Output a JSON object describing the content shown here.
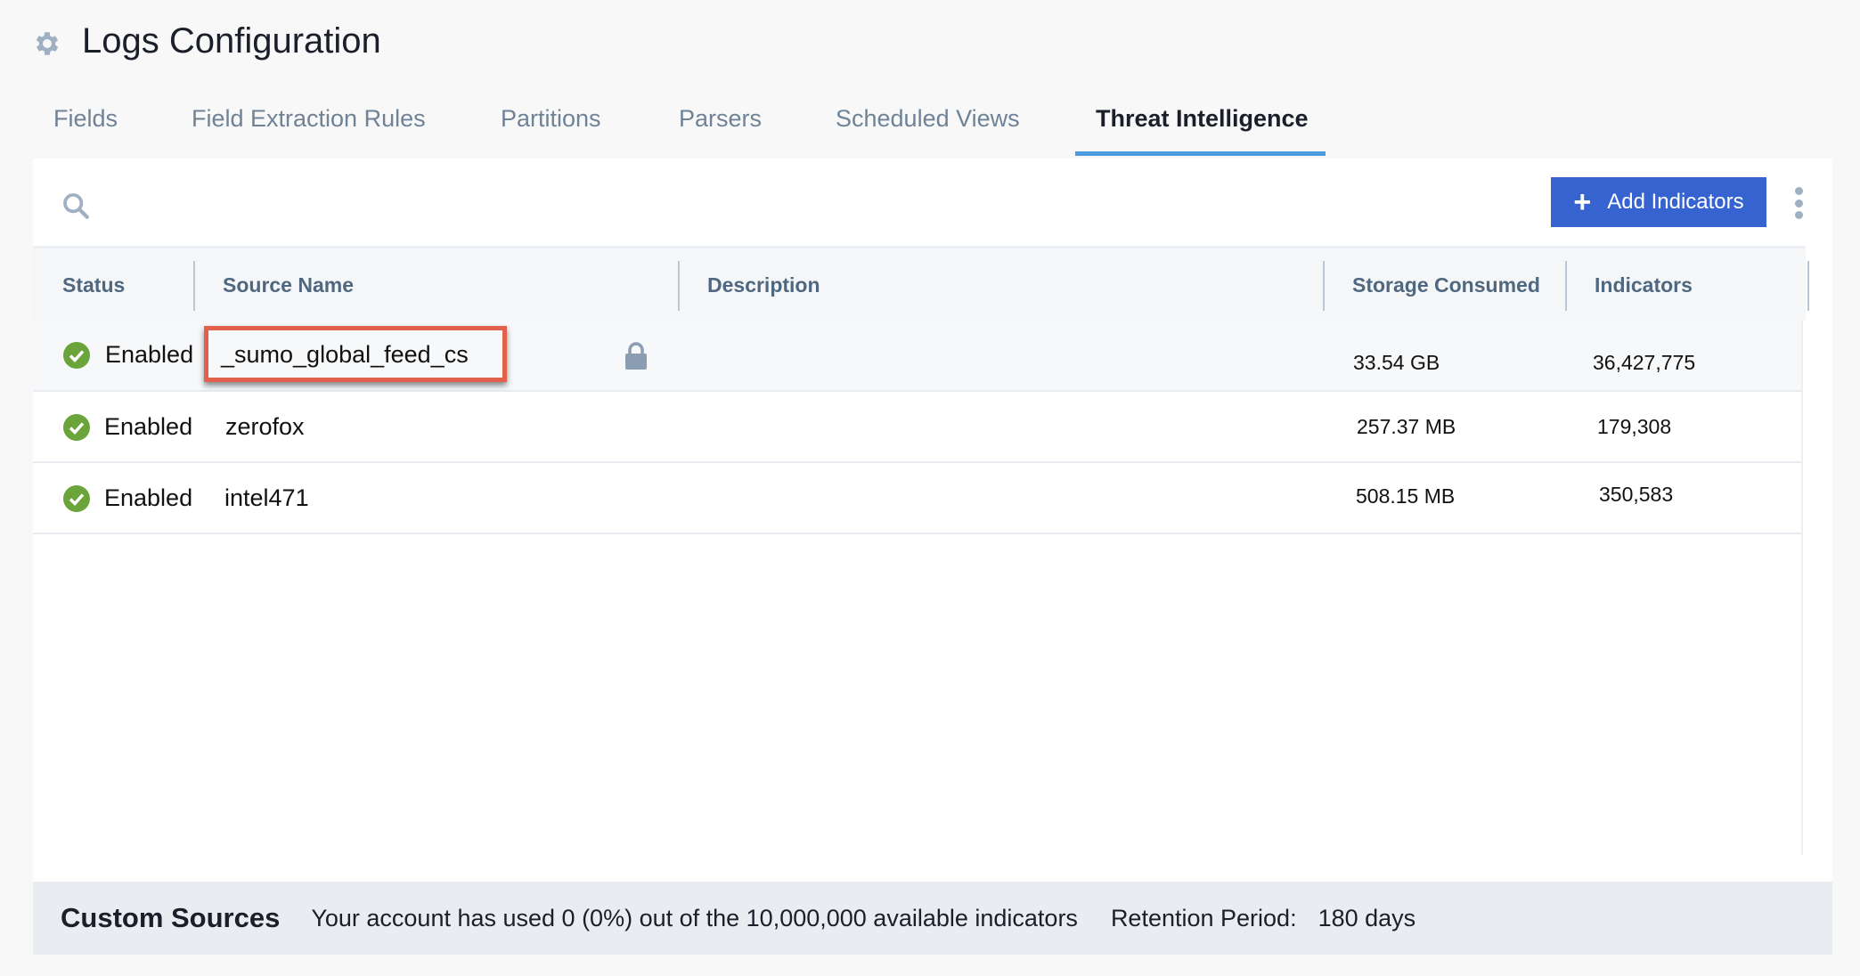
{
  "header": {
    "title": "Logs Configuration",
    "icon": "gear-icon"
  },
  "tabs": [
    {
      "label": "Fields",
      "active": false
    },
    {
      "label": "Field Extraction Rules",
      "active": false
    },
    {
      "label": "Partitions",
      "active": false
    },
    {
      "label": "Parsers",
      "active": false
    },
    {
      "label": "Scheduled Views",
      "active": false
    },
    {
      "label": "Threat Intelligence",
      "active": true
    }
  ],
  "toolbar": {
    "add_label": "Add Indicators",
    "accent": "#3763d1"
  },
  "table": {
    "columns": [
      "Status",
      "Source Name",
      "Description",
      "Storage Consumed",
      "Indicators"
    ],
    "rows": [
      {
        "status": "Enabled",
        "source": "_sumo_global_feed_cs",
        "description": "",
        "storage": "33.54 GB",
        "indicators": "36,427,775",
        "locked": true,
        "highlighted": true
      },
      {
        "status": "Enabled",
        "source": "zerofox",
        "description": "",
        "storage": "257.37 MB",
        "indicators": "179,308"
      },
      {
        "status": "Enabled",
        "source": "intel471",
        "description": "",
        "storage": "508.15 MB",
        "indicators": "350,583"
      }
    ]
  },
  "footer": {
    "heading": "Custom Sources",
    "usage": "Your account has used 0 (0%) out of the 10,000,000 available indicators",
    "retention_label": "Retention Period:",
    "retention_value": "180 days"
  }
}
